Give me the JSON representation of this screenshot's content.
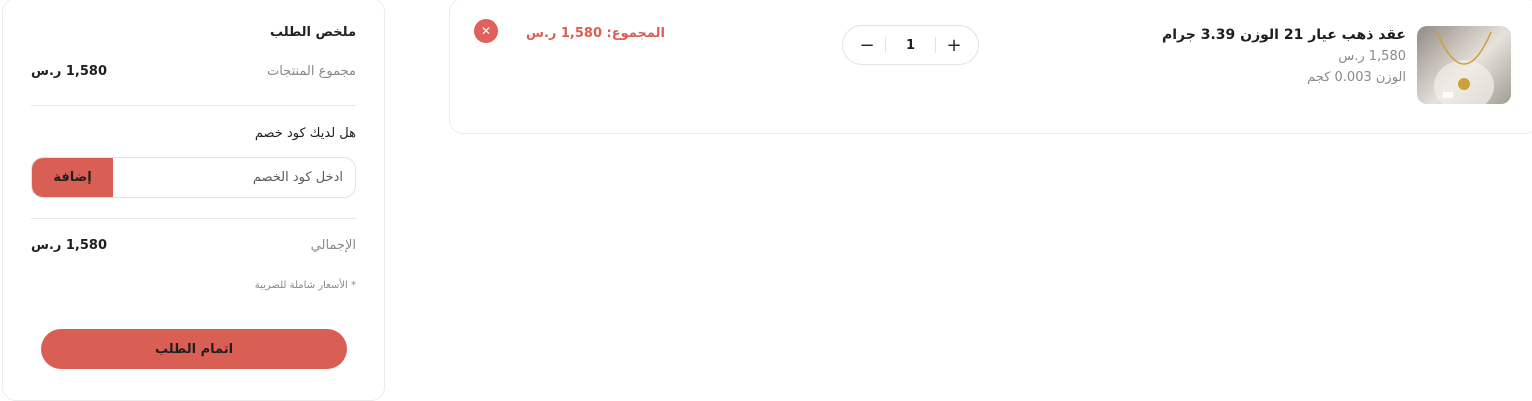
{
  "summary": {
    "title": "ملخص الطلب",
    "subtotal_label": "مجموع المنتجات",
    "subtotal_value": "1,580 ر.س",
    "coupon_question": "هل لديك كود خصم",
    "coupon_placeholder": "ادخل كود الخصم",
    "coupon_button": "إضافة",
    "total_label": "الإجمالي",
    "total_value": "1,580 ر.س",
    "tax_note": "* الأسعار شاملة للضريبة",
    "checkout_button": "اتمام الطلب"
  },
  "cart": {
    "items": [
      {
        "name": "عقد ذهب عيار 21 الوزن 3.39 جرام",
        "price": "1,580 ر.س",
        "weight": "الوزن 0.003 كجم",
        "quantity": "1",
        "line_total": "المجموع: 1,580 ر.س",
        "image_icon": "gold-necklace-image"
      }
    ]
  },
  "icons": {
    "plus": "+",
    "minus": "−",
    "remove": "✕"
  },
  "colors": {
    "accent": "#d95f55",
    "remove": "#e0605a"
  }
}
